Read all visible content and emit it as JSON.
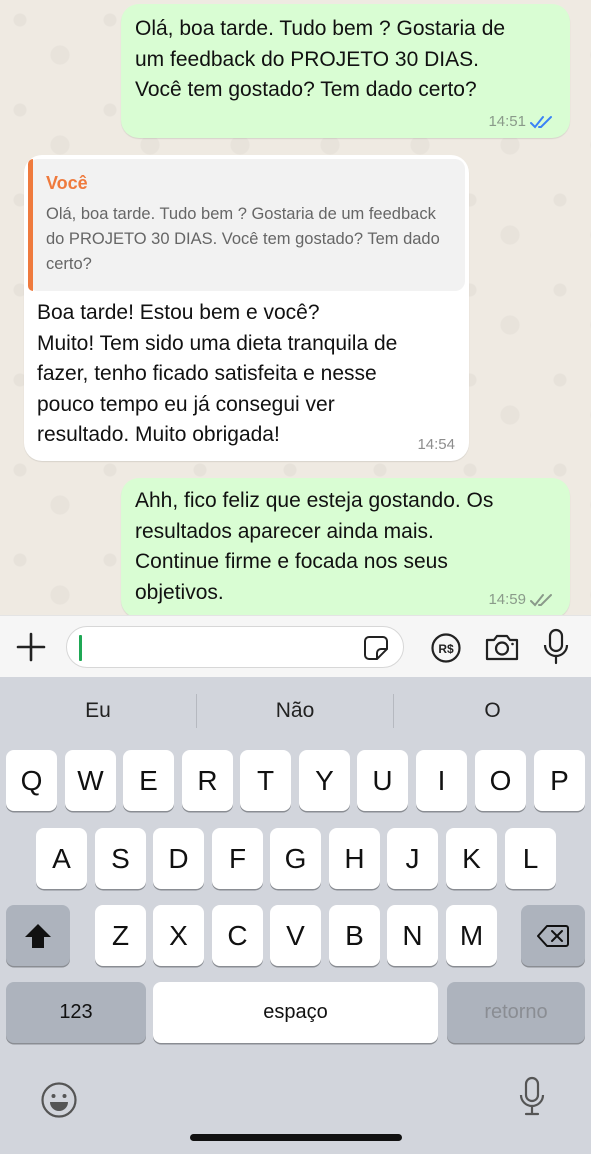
{
  "messages": [
    {
      "direction": "outgoing",
      "text": "Olá, boa tarde. Tudo bem ? Gostaria de\num feedback do PROJETO 30 DIAS.\nVocê tem gostado? Tem dado certo?",
      "time": "14:51",
      "status": "read"
    },
    {
      "direction": "incoming",
      "quote": {
        "author": "Você",
        "text": "Olá, boa tarde. Tudo bem ? Gostaria de um feedback do PROJETO 30 DIAS. Você tem gostado? Tem dado certo?"
      },
      "text": "Boa tarde! Estou bem e você?\nMuito! Tem sido uma dieta tranquila de\nfazer, tenho ficado satisfeita e nesse\npouco tempo eu já consegui ver\nresultado. Muito obrigada!",
      "time": "14:54"
    },
    {
      "direction": "outgoing",
      "text": "Ahh, fico feliz que esteja gostando. Os\nresultados aparecer ainda mais.\nContinue firme e focada nos seus\nobjetivos.",
      "time": "14:59",
      "status": "delivered"
    }
  ],
  "composer": {
    "value": "",
    "icons": [
      "plus-icon",
      "sticker-icon",
      "payment-icon",
      "camera-icon",
      "microphone-icon"
    ]
  },
  "keyboard": {
    "suggestions": [
      "Eu",
      "Não",
      "O"
    ],
    "row1": [
      "Q",
      "W",
      "E",
      "R",
      "T",
      "Y",
      "U",
      "I",
      "O",
      "P"
    ],
    "row2": [
      "A",
      "S",
      "D",
      "F",
      "G",
      "H",
      "J",
      "K",
      "L"
    ],
    "row3": [
      "Z",
      "X",
      "C",
      "V",
      "B",
      "N",
      "M"
    ],
    "numbers_label": "123",
    "space_label": "espaço",
    "return_label": "retorno"
  },
  "colors": {
    "outgoing_bubble": "#d9fdd3",
    "incoming_bubble": "#ffffff",
    "quote_accent": "#ef7a3d",
    "read_ticks": "#3b82f6",
    "caret": "#1fa855"
  }
}
